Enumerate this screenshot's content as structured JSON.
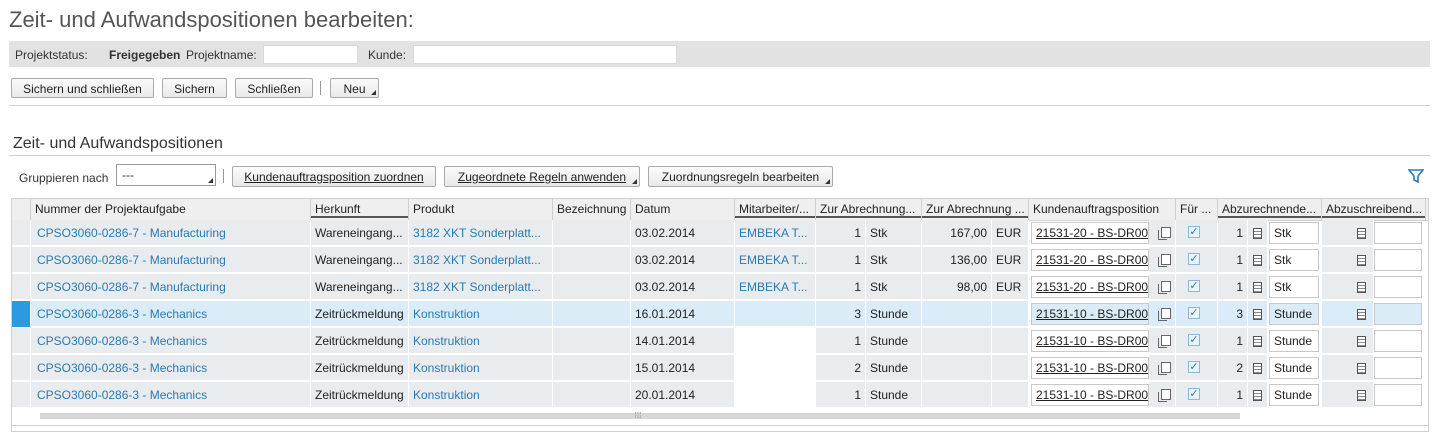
{
  "page": {
    "title": "Zeit- und Aufwandspositionen bearbeiten:"
  },
  "status": {
    "projektstatus_label": "Projektstatus:",
    "projektstatus_value": "Freigegeben",
    "projektname_label": "Projektname:",
    "projektname_value": "",
    "kunde_label": "Kunde:",
    "kunde_value": ""
  },
  "toolbar": {
    "save_close": "Sichern und schließen",
    "save": "Sichern",
    "close": "Schließen",
    "new": "Neu"
  },
  "section": {
    "title": "Zeit- und Aufwandspositionen",
    "group_label": "Gruppieren nach",
    "group_value": "---",
    "assign_btn": "Kundenauftragsposition zuordnen",
    "apply_rules_btn": "Zugeordnete Regeln anwenden",
    "edit_rules_btn": "Zuordnungsregeln bearbeiten"
  },
  "table": {
    "headers": [
      "Nummer der Projektaufgabe",
      "Herkunft",
      "Produkt",
      "Bezeichnung",
      "Datum",
      "Mitarbeiter/...",
      "Zur Abrechnung...",
      "Zur Abrechnung ...",
      "Kundenauftragsposition",
      "Für ...",
      "Abzurechnende...",
      "Abzuschreibend..."
    ],
    "rows": [
      {
        "task": "CPSO3060-0286-7 - Manufacturing",
        "herkunft": "Wareneingang...",
        "produkt": "3182 XKT Sonderplatt...",
        "bez": "",
        "datum": "03.02.2014",
        "mitarbeiter": "EMBEKA T...",
        "qty": "1",
        "unit": "Stk",
        "amount": "167,00",
        "currency": "EUR",
        "sales_order": "21531-20 - BS-DR00",
        "check": "✓",
        "bill_qty": "1",
        "bill_unit": "Stk"
      },
      {
        "task": "CPSO3060-0286-7 - Manufacturing",
        "herkunft": "Wareneingang...",
        "produkt": "3182 XKT Sonderplatt...",
        "bez": "",
        "datum": "03.02.2014",
        "mitarbeiter": "EMBEKA T...",
        "qty": "1",
        "unit": "Stk",
        "amount": "136,00",
        "currency": "EUR",
        "sales_order": "21531-20 - BS-DR00",
        "check": "✓",
        "bill_qty": "1",
        "bill_unit": "Stk"
      },
      {
        "task": "CPSO3060-0286-7 - Manufacturing",
        "herkunft": "Wareneingang...",
        "produkt": "3182 XKT Sonderplatt...",
        "bez": "",
        "datum": "03.02.2014",
        "mitarbeiter": "EMBEKA T...",
        "qty": "1",
        "unit": "Stk",
        "amount": "98,00",
        "currency": "EUR",
        "sales_order": "21531-20 - BS-DR00",
        "check": "✓",
        "bill_qty": "1",
        "bill_unit": "Stk"
      },
      {
        "task": "CPSO3060-0286-3 - Mechanics",
        "herkunft": "Zeitrückmeldung",
        "produkt": "Konstruktion",
        "bez": "",
        "datum": "16.01.2014",
        "mitarbeiter": "",
        "qty": "3",
        "unit": "Stunde",
        "amount": "",
        "currency": "",
        "sales_order": "21531-10 - BS-DR00",
        "check": "✓",
        "bill_qty": "3",
        "bill_unit": "Stunde"
      },
      {
        "task": "CPSO3060-0286-3 - Mechanics",
        "herkunft": "Zeitrückmeldung",
        "produkt": "Konstruktion",
        "bez": "",
        "datum": "14.01.2014",
        "mitarbeiter": "",
        "qty": "1",
        "unit": "Stunde",
        "amount": "",
        "currency": "",
        "sales_order": "21531-10 - BS-DR00",
        "check": "✓",
        "bill_qty": "1",
        "bill_unit": "Stunde"
      },
      {
        "task": "CPSO3060-0286-3 - Mechanics",
        "herkunft": "Zeitrückmeldung",
        "produkt": "Konstruktion",
        "bez": "",
        "datum": "15.01.2014",
        "mitarbeiter": "",
        "qty": "2",
        "unit": "Stunde",
        "amount": "",
        "currency": "",
        "sales_order": "21531-10 - BS-DR00",
        "check": "✓",
        "bill_qty": "2",
        "bill_unit": "Stunde"
      },
      {
        "task": "CPSO3060-0286-3 - Mechanics",
        "herkunft": "Zeitrückmeldung",
        "produkt": "Konstruktion",
        "bez": "",
        "datum": "20.01.2014",
        "mitarbeiter": "",
        "qty": "1",
        "unit": "Stunde",
        "amount": "",
        "currency": "",
        "sales_order": "21531-10 - BS-DR00",
        "check": "✓",
        "bill_qty": "1",
        "bill_unit": "Stunde"
      }
    ]
  },
  "colors": {
    "link": "#2a7ab0",
    "selection": "#2a9be0"
  }
}
